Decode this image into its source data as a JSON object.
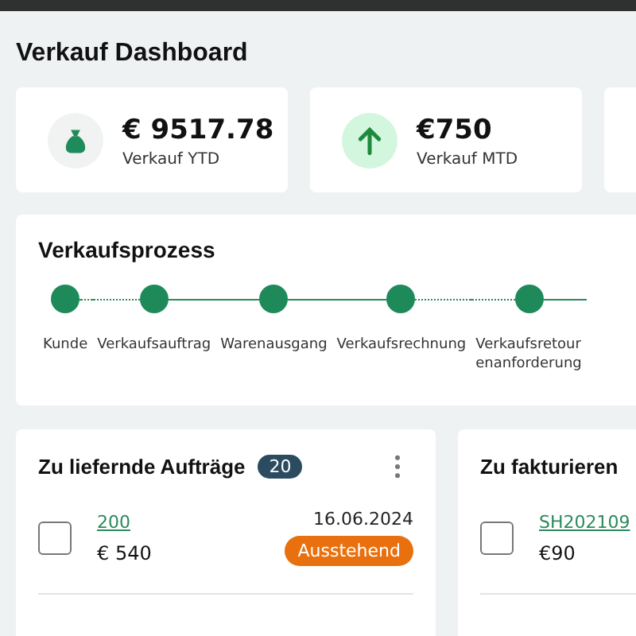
{
  "page": {
    "title": "Verkauf Dashboard"
  },
  "kpis": [
    {
      "kind": "bag",
      "value": "€ 9517.78",
      "label": "Verkauf YTD"
    },
    {
      "kind": "arrow",
      "value": "€750",
      "label": "Verkauf MTD"
    },
    {
      "kind": "empty"
    }
  ],
  "process": {
    "title": "Verkaufsprozess",
    "steps": [
      {
        "label": "Kunde",
        "dotted": true
      },
      {
        "label": "Verkaufsauftrag",
        "dotted": false
      },
      {
        "label": "Warenausgang",
        "dotted": false
      },
      {
        "label": "Verkaufsrechnung",
        "dotted": true
      },
      {
        "label": "Verkaufsretour\nenanforderung",
        "dotted": false
      }
    ]
  },
  "lists": [
    {
      "title": "Zu liefernde Aufträge",
      "count": "20",
      "menu": true,
      "rows": [
        {
          "checked": false,
          "link": "200",
          "amount": "€ 540",
          "date": "16.06.2024",
          "status": "Ausstehend"
        }
      ]
    },
    {
      "title": "Zu fakturieren",
      "menu": false,
      "rows": [
        {
          "checked": false,
          "link": "SH202109",
          "amount": "€90"
        }
      ]
    }
  ]
}
